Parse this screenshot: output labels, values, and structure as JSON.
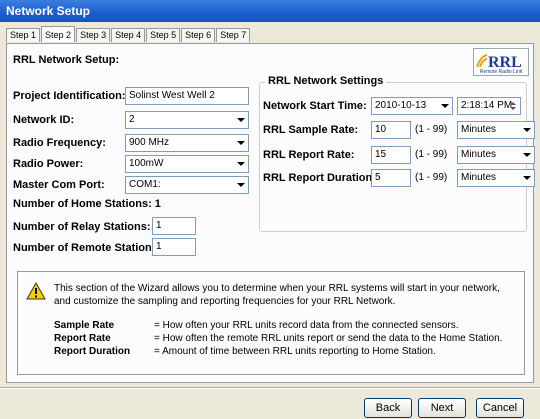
{
  "window": {
    "title": "Network Setup"
  },
  "tabs": [
    "Step 1",
    "Step 2",
    "Step 3",
    "Step 4",
    "Step 5",
    "Step 6",
    "Step 7"
  ],
  "active_tab": "Step 2",
  "section_title": "RRL Network Setup:",
  "logo": {
    "text": "RRL",
    "subtitle": "Remote Radio Link"
  },
  "form": {
    "project_label": "Project Identification:",
    "project_value": "Solinst West Well 2",
    "network_id_label": "Network ID:",
    "network_id_value": "2",
    "radio_freq_label": "Radio Frequency:",
    "radio_freq_value": "900 MHz",
    "radio_power_label": "Radio Power:",
    "radio_power_value": "100mW",
    "master_port_label": "Master Com Port:",
    "master_port_value": "COM1:",
    "home_stations_label": "Number of Home Stations:",
    "home_stations_value": "1",
    "relay_stations_label": "Number of Relay Stations:",
    "relay_stations_value": "1",
    "remote_stations_label": "Number of Remote Stations:",
    "remote_stations_value": "1"
  },
  "settings": {
    "group_title": "RRL Network Settings",
    "start_time_label": "Network Start Time:",
    "start_date": "2010-10-13",
    "start_time": "2:18:14 PM",
    "sample_label": "RRL Sample Rate:",
    "sample_value": "10",
    "sample_range": "(1 - 99)",
    "sample_unit": "Minutes",
    "report_label": "RRL Report Rate:",
    "report_value": "15",
    "report_range": "(1 - 99)",
    "report_unit": "Minutes",
    "duration_label": "RRL Report Duration:",
    "duration_value": "5",
    "duration_range": "(1 - 99)",
    "duration_unit": "Minutes"
  },
  "info": {
    "text": "This section of the Wizard allows you to determine when your RRL systems will start in your network, and customize the sampling and reporting frequencies for your RRL Network.",
    "definitions": [
      {
        "term": "Sample Rate",
        "desc": "= How often your RRL units record data from the connected sensors."
      },
      {
        "term": "Report Rate",
        "desc": "= How often the remote RRL units report or send the data to the Home Station."
      },
      {
        "term": "Report Duration",
        "desc": "= Amount of time between RRL units reporting to Home Station."
      }
    ]
  },
  "buttons": {
    "back": "Back",
    "next": "Next",
    "cancel": "Cancel"
  },
  "colors": {
    "titlebar": "#1d5dd0",
    "warning_icon": "#f5d000"
  }
}
